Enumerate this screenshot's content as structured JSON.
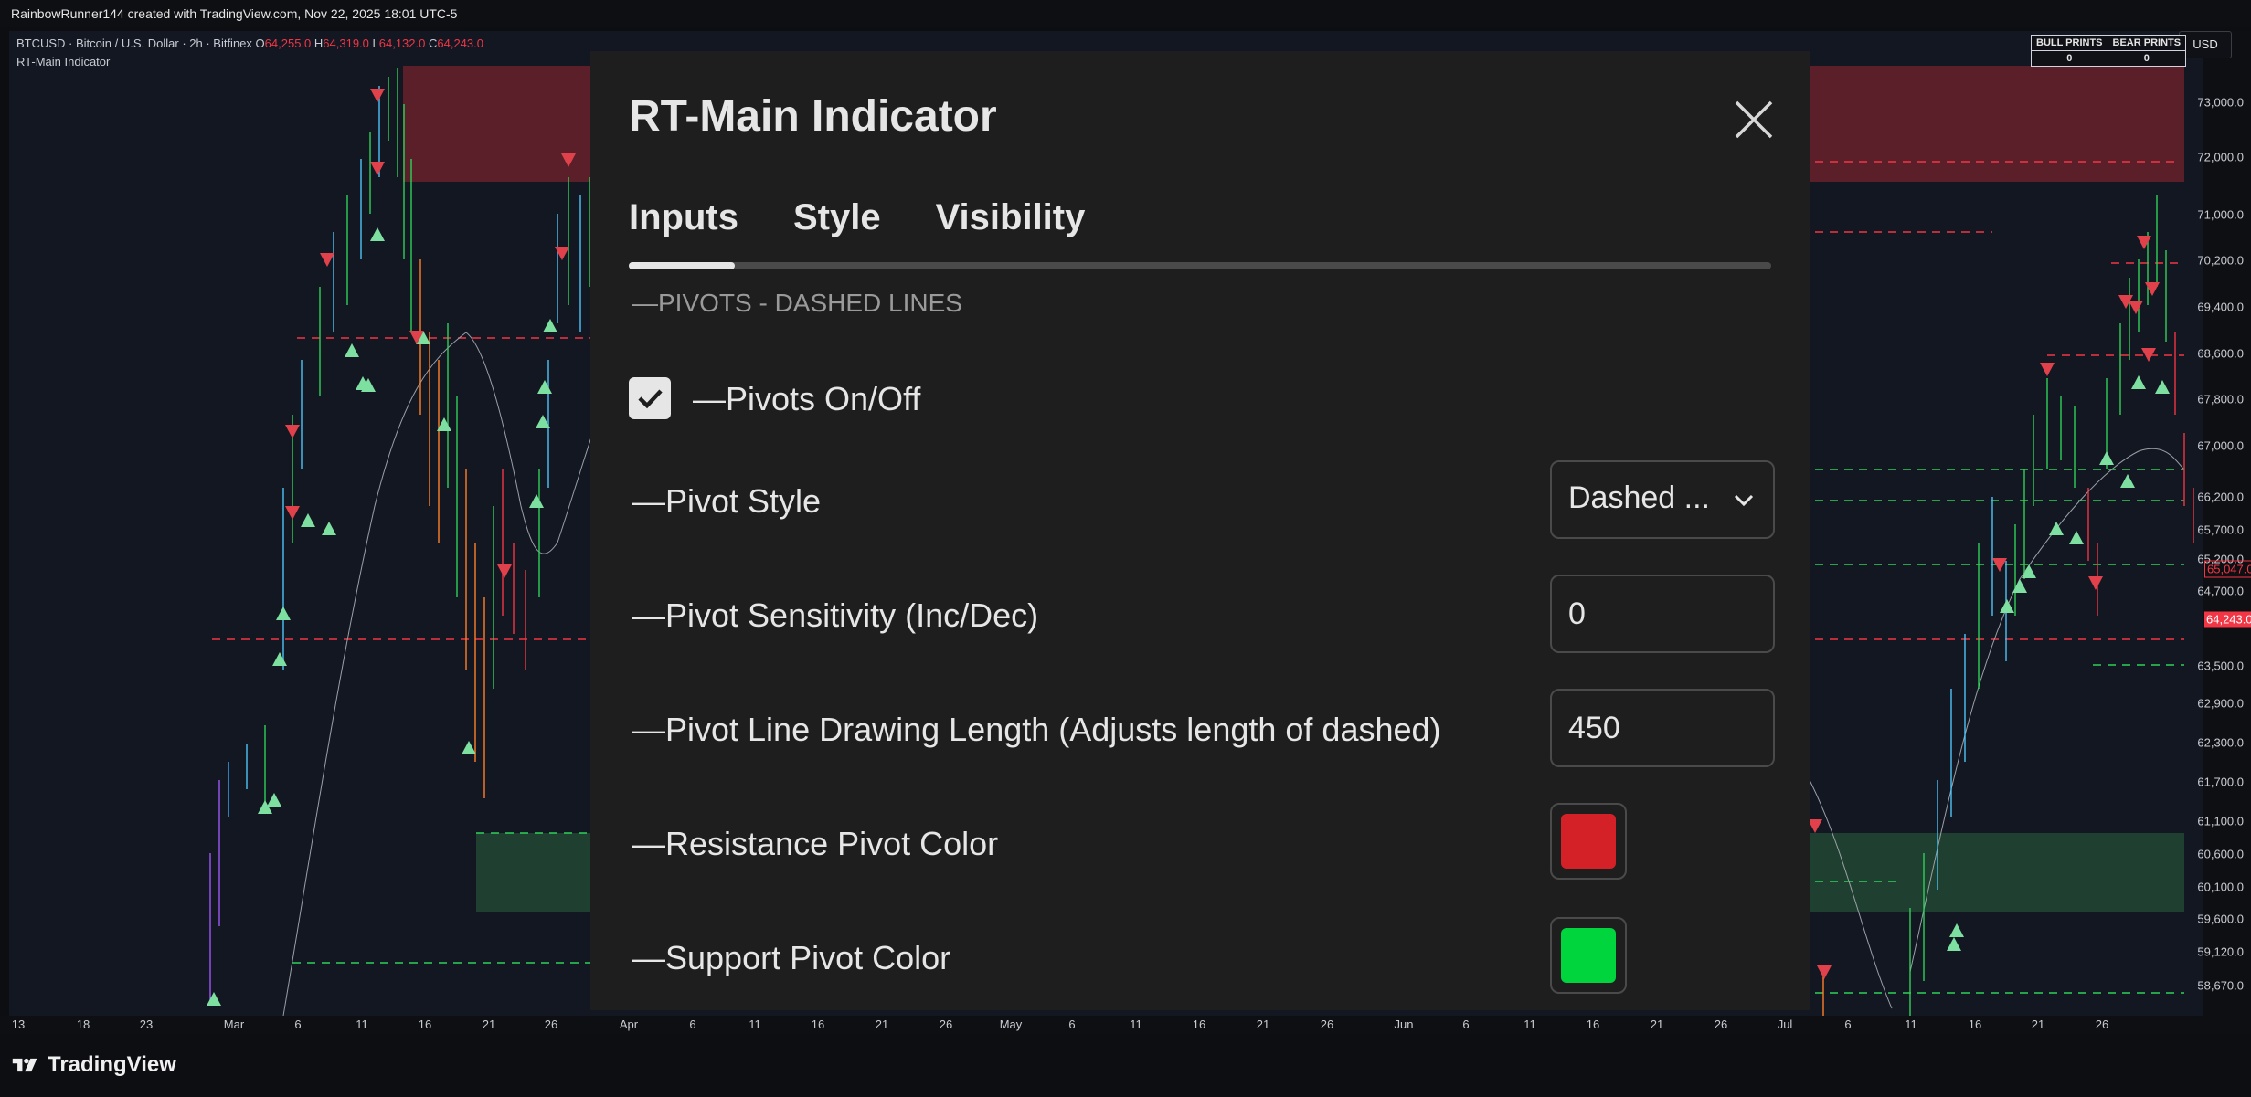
{
  "header": {
    "credit": "RainbowRunner144 created with TradingView.com, Nov 22, 2025 18:01 UTC-5"
  },
  "legend": {
    "symbol": "BTCUSD · Bitcoin / U.S. Dollar · 2h · Bitfinex",
    "o_label": "O",
    "o_value": "64,255.0",
    "h_label": "H",
    "h_value": "64,319.0",
    "l_label": "L",
    "l_value": "64,132.0",
    "c_label": "C",
    "c_value": "64,243.0",
    "indicator": "RT-Main Indicator"
  },
  "prints_table": {
    "bull_label": "BULL PRINTS",
    "bear_label": "BEAR PRINTS",
    "bull_value": "0",
    "bear_value": "0"
  },
  "currency_button": "USD",
  "y_axis": {
    "labels": [
      "73,000.0",
      "72,000.0",
      "71,000.0",
      "70,200.0",
      "69,400.0",
      "68,600.0",
      "67,800.0",
      "67,000.0",
      "66,200.0",
      "65,700.0",
      "65,200.0",
      "64,700.0",
      "63,500.0",
      "62,900.0",
      "62,300.0",
      "61,700.0",
      "61,100.0",
      "60,600.0",
      "60,100.0",
      "59,600.0",
      "59,120.0",
      "58,670.0"
    ],
    "tag_pivot": "65,047.0",
    "tag_price": "64,243.0",
    "tag_pivot_color": "#f23645",
    "tag_price_color": "#f23645"
  },
  "x_axis": {
    "labels": [
      "13",
      "18",
      "23",
      "Mar",
      "6",
      "11",
      "16",
      "21",
      "26",
      "Apr",
      "6",
      "11",
      "16",
      "21",
      "26",
      "May",
      "6",
      "11",
      "16",
      "21",
      "26",
      "Jun",
      "6",
      "11",
      "16",
      "21",
      "26",
      "Jul",
      "6",
      "11",
      "16",
      "21",
      "26"
    ]
  },
  "footer": {
    "brand": "TradingView"
  },
  "dialog": {
    "title": "RT-Main Indicator",
    "tabs": [
      "Inputs",
      "Style",
      "Visibility"
    ],
    "active_tab": "Inputs",
    "section": "PIVOTS - DASHED LINES",
    "pivots_toggle": {
      "label": "Pivots On/Off",
      "checked": true
    },
    "pivot_style": {
      "label": "Pivot Style",
      "value": "Dashed ..."
    },
    "pivot_sensitivity": {
      "label": "Pivot Sensitivity (Inc/Dec)",
      "value": "0"
    },
    "pivot_length": {
      "label": "Pivot Line Drawing Length (Adjusts length of dashed)",
      "value": "450"
    },
    "resistance_color": {
      "label": "Resistance Pivot Color",
      "color": "#d42127"
    },
    "support_color": {
      "label": "Support Pivot Color",
      "color": "#00d53d"
    }
  },
  "colors": {
    "resistance_zone": "#5a1f28",
    "support_zone": "#1f4030",
    "dashed_red": "#f23645",
    "dashed_green": "#2ed158",
    "chart_bg": "#131722"
  }
}
